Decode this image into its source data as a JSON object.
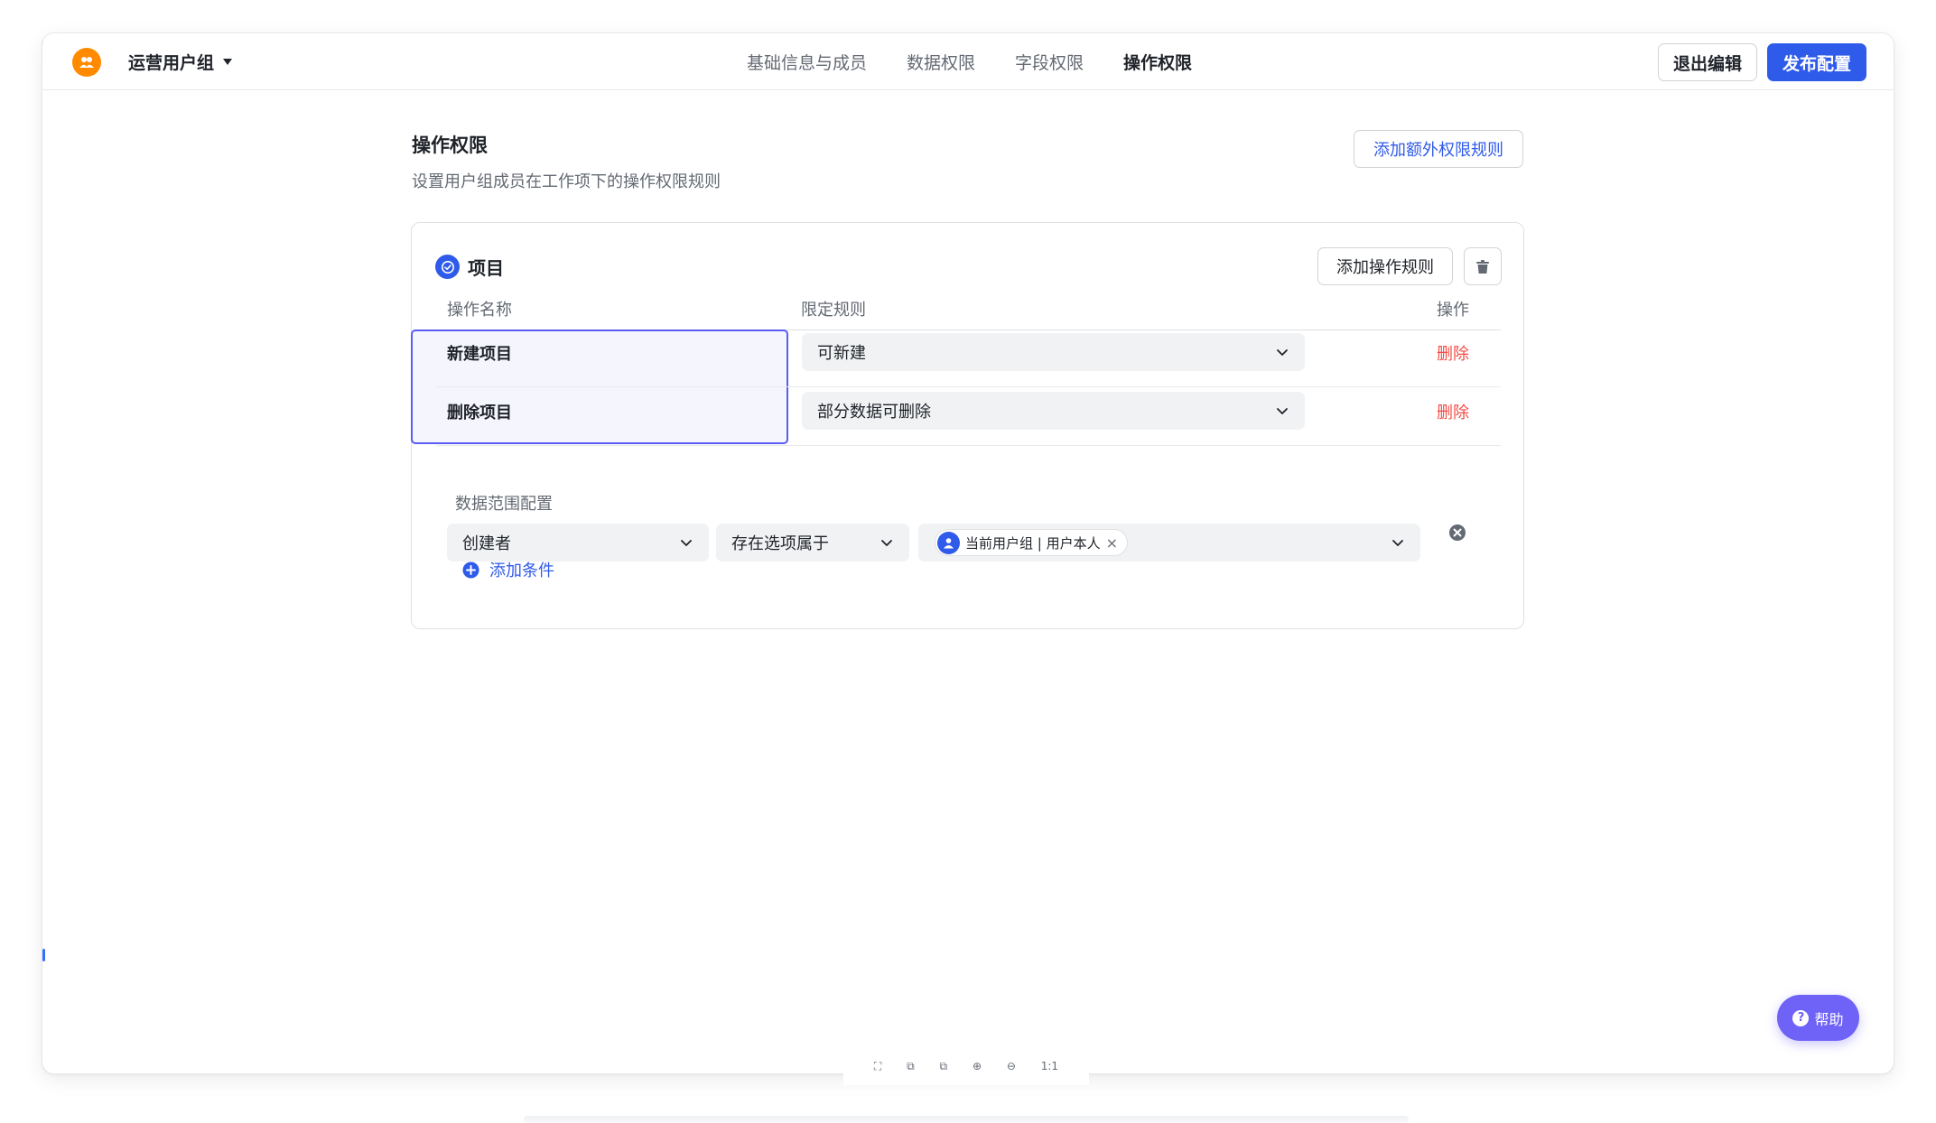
{
  "header": {
    "group_name": "运营用户组",
    "tabs": [
      {
        "label": "基础信息与成员"
      },
      {
        "label": "数据权限"
      },
      {
        "label": "字段权限"
      },
      {
        "label": "操作权限"
      }
    ],
    "active_tab": "操作权限",
    "exit_label": "退出编辑",
    "publish_label": "发布配置"
  },
  "page": {
    "title": "操作权限",
    "description": "设置用户组成员在工作项下的操作权限规则",
    "add_extra_label": "添加额外权限规则"
  },
  "card": {
    "title": "项目",
    "add_rule_label": "添加操作规则",
    "columns": {
      "name": "操作名称",
      "rule": "限定规则",
      "action": "操作"
    },
    "rows": [
      {
        "name": "新建项目",
        "rule": "可新建",
        "action": "删除"
      },
      {
        "name": "删除项目",
        "rule": "部分数据可删除",
        "action": "删除"
      }
    ],
    "scope": {
      "label": "数据范围配置",
      "field": "创建者",
      "operator": "存在选项属于",
      "value_tag": "当前用户组 | 用户本人",
      "tag_close": "×",
      "add_condition_label": "添加条件"
    }
  },
  "toolbar": {
    "items": [
      "⛶",
      "⧉",
      "⧉",
      "⊕",
      "⊖",
      "1:1"
    ]
  },
  "help": {
    "label": "帮助",
    "icon_glyph": "?"
  },
  "colors": {
    "primary": "#2f5bea",
    "danger": "#f54a45",
    "avatar": "#ff8a00",
    "help": "#6f62f6",
    "selection": "#5b5cf0"
  }
}
